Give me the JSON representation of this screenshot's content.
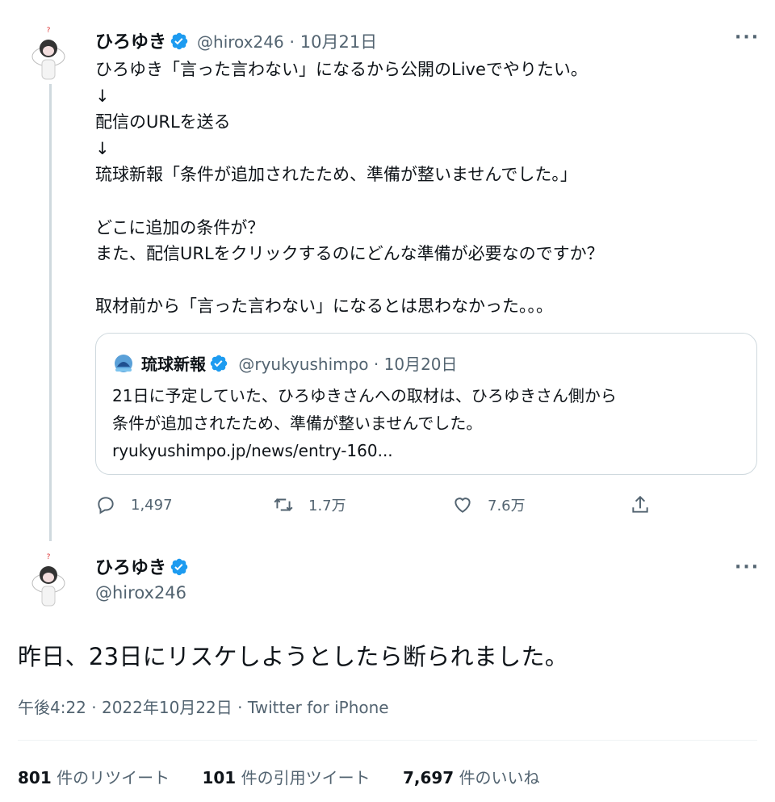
{
  "tweet1": {
    "author_name": "ひろゆき",
    "handle": "@hirox246",
    "separator": "·",
    "date": "10月21日",
    "more": "···",
    "lines": [
      "ひろゆき「言った言わない」になるから公開のLiveでやりたい。",
      "↓",
      "配信のURLを送る",
      "↓",
      "琉球新報「条件が追加されたため、準備が整いませんでした。」",
      "",
      "どこに追加の条件が？",
      "また、配信URLをクリックするのにどんな準備が必要なのですか？",
      "",
      "取材前から「言った言わない」になるとは思わなかった。。。"
    ],
    "quote": {
      "author_name": "琉球新報",
      "handle": "@ryukyushimpo",
      "date": "10月20日",
      "lines": [
        "21日に予定していた、ひろゆきさんへの取材は、ひろゆきさん側から",
        "条件が追加されたため、準備が整いませんでした。",
        "ryukyushimpo.jp/news/entry-160..."
      ]
    },
    "actions": {
      "replies": "1,497",
      "retweets": "1.7万",
      "likes": "7.6万"
    }
  },
  "tweet2": {
    "author_name": "ひろゆき",
    "handle": "@hirox246",
    "more": "···",
    "text": "昨日、23日にリスケしようとしたら断られました。",
    "meta": "午後4:22 · 2022年10月22日 · Twitter for iPhone",
    "stats": {
      "retweets_count": "801",
      "retweets_label": "件のリツイート",
      "quotes_count": "101",
      "quotes_label": "件の引用ツイート",
      "likes_count": "7,697",
      "likes_label": "件のいいね"
    }
  },
  "colors": {
    "verified": "#1d9bf0",
    "muted": "#536471",
    "border": "#cfd9de"
  }
}
